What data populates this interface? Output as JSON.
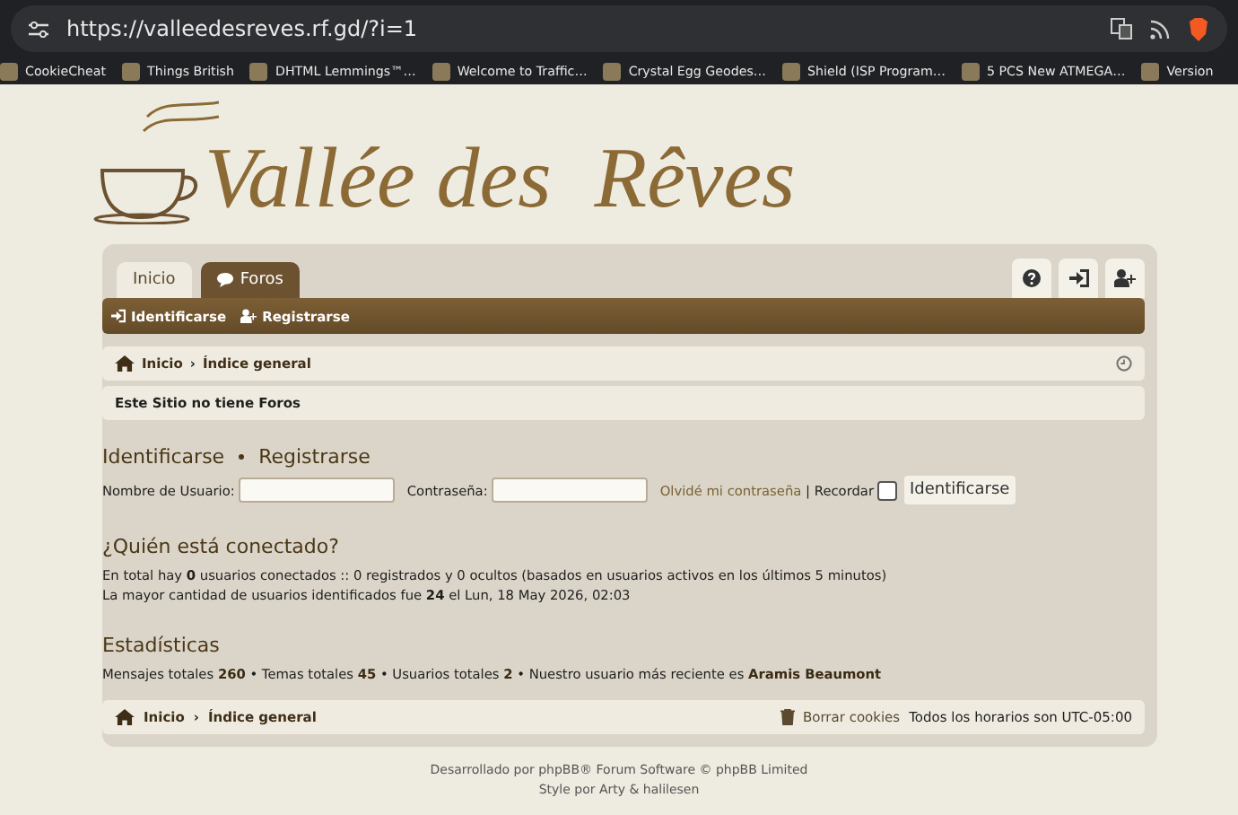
{
  "browser": {
    "url": "https://valleedesreves.rf.gd/?i=1",
    "bookmarks": [
      {
        "label": "CookieCheat"
      },
      {
        "label": "Things British"
      },
      {
        "label": "DHTML Lemmings™…"
      },
      {
        "label": "Welcome to Traffic…"
      },
      {
        "label": "Crystal Egg Geodes…"
      },
      {
        "label": "Shield (ISP Program…"
      },
      {
        "label": "5 PCS New ATMEGA…"
      },
      {
        "label": "Version"
      }
    ]
  },
  "site": {
    "title": "Vallée des  Rêves"
  },
  "tabs": [
    {
      "label": "Inicio",
      "selected": false
    },
    {
      "label": "Foros",
      "selected": true
    }
  ],
  "navbar": {
    "links": [
      "Identificarse",
      "Registrarse"
    ]
  },
  "breadcrumb": {
    "home": "Inicio",
    "separator": "›",
    "current": "Índice general"
  },
  "notice": "Este Sitio no tiene Foros",
  "login": {
    "headings": [
      "Identificarse",
      "Registrarse"
    ],
    "username_label": "Nombre de Usuario:",
    "password_label": "Contraseña:",
    "forgot_link": "Olvidé mi contraseña",
    "separator": "|",
    "remember_label": "Recordar",
    "remember_checked": false,
    "submit": "Identificarse"
  },
  "online": {
    "heading": "¿Quién está conectado?",
    "lines": [
      "En total hay **0** usuarios conectados :: 0 registrados y 0 ocultos (basados en usuarios activos en los últimos 5 minutos)",
      "La mayor cantidad de usuarios identificados fue **24** el Lun, 18 May 2026, 02:03"
    ]
  },
  "stats": {
    "heading": "Estadísticas",
    "line": "Mensajes totales **260** • Temas totales **45** • Usuarios totales **2** • Nuestro usuario más reciente es **Aramis Beaumont**"
  },
  "footer_bar": {
    "home": "Inicio",
    "separator": "›",
    "current": "Índice general",
    "delete_cookies": "Borrar cookies",
    "timezone": "Todos los horarios son UTC-05:00"
  },
  "credits": [
    "Desarrollado por phpBB® Forum Software © phpBB Limited",
    "Style por Arty & halilesen"
  ]
}
